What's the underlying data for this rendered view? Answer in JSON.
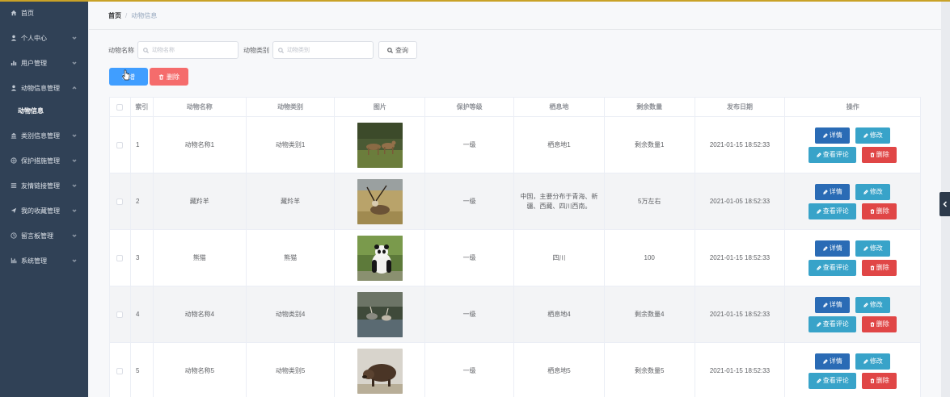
{
  "sidebar": {
    "items": [
      {
        "label": "首页",
        "icon": "home-icon",
        "has_children": false
      },
      {
        "label": "个人中心",
        "icon": "user-icon",
        "has_children": true
      },
      {
        "label": "用户管理",
        "icon": "chart-icon",
        "has_children": true
      },
      {
        "label": "动物信息管理",
        "icon": "user-icon",
        "has_children": true,
        "expanded": true
      },
      {
        "label": "动物信息",
        "icon": "",
        "has_children": false,
        "sub": true
      },
      {
        "label": "类别信息管理",
        "icon": "bank-icon",
        "has_children": true
      },
      {
        "label": "保护措施管理",
        "icon": "globe-icon",
        "has_children": true
      },
      {
        "label": "友情链接管理",
        "icon": "list-icon",
        "has_children": true
      },
      {
        "label": "我的收藏管理",
        "icon": "send-icon",
        "has_children": true
      },
      {
        "label": "留言板管理",
        "icon": "clock-icon",
        "has_children": true
      },
      {
        "label": "系统管理",
        "icon": "bar-chart-icon",
        "has_children": true
      }
    ]
  },
  "breadcrumb": {
    "home": "首页",
    "separator": "/",
    "current": "动物信息"
  },
  "search": {
    "name_label": "动物名称",
    "name_placeholder": "动物名称",
    "category_label": "动物类别",
    "category_placeholder": "动物类别",
    "query_button": "查询"
  },
  "actions": {
    "add_label": "新增",
    "delete_label": "删除"
  },
  "table": {
    "headers": [
      "索引",
      "动物名称",
      "动物类别",
      "图片",
      "保护等级",
      "栖息地",
      "剩余数量",
      "发布日期",
      "操作"
    ],
    "rows": [
      {
        "index": "1",
        "name": "动物名称1",
        "category": "动物类别1",
        "image": "deer-photo",
        "level": "一级",
        "habitat": "栖息地1",
        "count": "剩余数量1",
        "date": "2021-01-15 18:52:33"
      },
      {
        "index": "2",
        "name": "藏羚羊",
        "category": "藏羚羊",
        "image": "antelope-photo",
        "level": "一级",
        "habitat": "中国，主要分布于青海、新疆、西藏、四川西南。",
        "count": "5万左右",
        "date": "2021-01-05 18:52:33"
      },
      {
        "index": "3",
        "name": "熊猫",
        "category": "熊猫",
        "image": "panda-photo",
        "level": "一级",
        "habitat": "四川",
        "count": "100",
        "date": "2021-01-15 18:52:33"
      },
      {
        "index": "4",
        "name": "动物名称4",
        "category": "动物类别4",
        "image": "bird-photo",
        "level": "一级",
        "habitat": "栖息地4",
        "count": "剩余数量4",
        "date": "2021-01-15 18:52:33"
      },
      {
        "index": "5",
        "name": "动物名称5",
        "category": "动物类别5",
        "image": "boar-photo",
        "level": "一级",
        "habitat": "栖息地5",
        "count": "剩余数量5",
        "date": "2021-01-15 18:52:33"
      }
    ],
    "row_actions": {
      "detail": "详情",
      "edit": "修改",
      "review": "查看评论",
      "delete": "删除"
    }
  },
  "colors": {
    "sidebar_bg": "#304156",
    "primary": "#409eff",
    "danger": "#f56c6c",
    "info": "#38a3c9",
    "detail": "#2a6bb5"
  }
}
